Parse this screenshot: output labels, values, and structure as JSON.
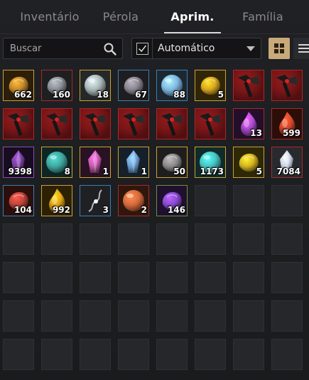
{
  "tabs": [
    {
      "label": "Inventário",
      "active": false
    },
    {
      "label": "Pérola",
      "active": false
    },
    {
      "label": "Aprim.",
      "active": true
    },
    {
      "label": "Família",
      "active": false
    }
  ],
  "search": {
    "placeholder": "Buscar",
    "value": ""
  },
  "filter": {
    "checked": true,
    "selected": "Automático"
  },
  "view_mode": "grid",
  "colors": {
    "active_view_button": "#c8a97a",
    "tab_active": "#ffffff",
    "tab_inactive": "#8a8a8a"
  },
  "slots": [
    {
      "icon": "amber-ring-stone-icon",
      "qty": "662",
      "rarity": "yellow",
      "color": "#c78a2a"
    },
    {
      "icon": "grey-ore-chunk-icon",
      "qty": "160",
      "rarity": "red",
      "color": "#8a8f96"
    },
    {
      "icon": "silver-crystal-orb-icon",
      "qty": "18",
      "rarity": "yellow",
      "color": "#a9b6b8"
    },
    {
      "icon": "dark-iron-ore-icon",
      "qty": "67",
      "rarity": "blue",
      "color": "#8a8590"
    },
    {
      "icon": "blue-gem-orb-icon",
      "qty": "88",
      "rarity": "blue",
      "color": "#7fb6e0"
    },
    {
      "icon": "gold-stone-icon",
      "qty": "5",
      "rarity": "yellow",
      "color": "#d9a81e"
    },
    {
      "icon": "crimson-hammer-icon",
      "qty": "",
      "rarity": "red",
      "color": "#a01e1e"
    },
    {
      "icon": "crimson-hammer-icon",
      "qty": "",
      "rarity": "red",
      "color": "#a01e1e"
    },
    {
      "icon": "crimson-hammer-icon",
      "qty": "",
      "rarity": "red",
      "color": "#a01e1e"
    },
    {
      "icon": "crimson-hammer-icon",
      "qty": "",
      "rarity": "red",
      "color": "#a01e1e"
    },
    {
      "icon": "crimson-hammer-icon",
      "qty": "",
      "rarity": "red",
      "color": "#a01e1e"
    },
    {
      "icon": "crimson-hammer-icon",
      "qty": "",
      "rarity": "red",
      "color": "#a01e1e"
    },
    {
      "icon": "crimson-hammer-icon",
      "qty": "",
      "rarity": "red",
      "color": "#a01e1e"
    },
    {
      "icon": "crimson-hammer-icon",
      "qty": "",
      "rarity": "red",
      "color": "#a01e1e"
    },
    {
      "icon": "purple-flame-stone-icon",
      "qty": "13",
      "rarity": "red",
      "color": "#b04bd0"
    },
    {
      "icon": "red-flame-stone-icon",
      "qty": "599",
      "rarity": "red",
      "color": "#d8482a"
    },
    {
      "icon": "violet-shard-icon",
      "qty": "9398",
      "rarity": "purple",
      "color": "#7a3fa0"
    },
    {
      "icon": "teal-spotted-orb-icon",
      "qty": "8",
      "rarity": "yellow",
      "color": "#3fa7a0"
    },
    {
      "icon": "pink-crystal-icon",
      "qty": "1",
      "rarity": "yellow",
      "color": "#c85ab0"
    },
    {
      "icon": "blue-crystal-icon",
      "qty": "1",
      "rarity": "yellow",
      "color": "#6fa2d8"
    },
    {
      "icon": "grey-feather-stone-icon",
      "qty": "50",
      "rarity": "yellow",
      "color": "#8d8a8c"
    },
    {
      "icon": "aqua-orb-icon",
      "qty": "1173",
      "rarity": "yellow",
      "color": "#46c2c0"
    },
    {
      "icon": "gold-gem-cluster-icon",
      "qty": "5",
      "rarity": "yellow",
      "color": "#d6b422"
    },
    {
      "icon": "pearl-crystal-icon",
      "qty": "7084",
      "rarity": "red",
      "color": "#c9d2e4"
    },
    {
      "icon": "red-ore-stone-icon",
      "qty": "104",
      "rarity": "blue",
      "color": "#c0443a"
    },
    {
      "icon": "gold-flame-stone-icon",
      "qty": "992",
      "rarity": "yellow",
      "color": "#e0a414"
    },
    {
      "icon": "silver-necklace-icon",
      "qty": "3",
      "rarity": "blue",
      "color": "#b5b5b5"
    },
    {
      "icon": "orange-sphere-icon",
      "qty": "2",
      "rarity": "red",
      "color": "#d66a3c"
    },
    {
      "icon": "purple-ore-stone-icon",
      "qty": "146",
      "rarity": "green",
      "color": "#8a4ad0"
    }
  ],
  "total_slots": 64
}
